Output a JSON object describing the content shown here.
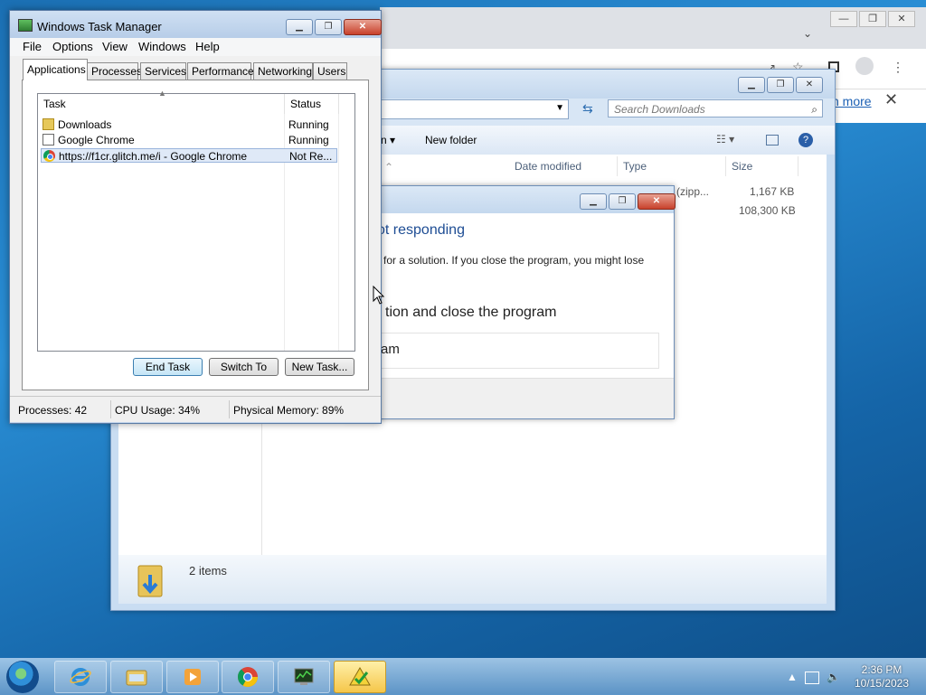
{
  "chrome_window": {
    "link_text": "n more",
    "close_glyph": "✕",
    "win_buttons": [
      "—",
      "❐",
      "✕"
    ]
  },
  "explorer": {
    "search_placeholder": "Search Downloads",
    "toolbar_fragment": "n ▾",
    "new_folder_label": "New folder",
    "columns": [
      "Date modified",
      "Type",
      "Size"
    ],
    "rows": [
      {
        "type": "d (zipp...",
        "size": "1,167 KB"
      },
      {
        "type": "n",
        "size": "108,300 KB"
      }
    ],
    "item_count": "2 items"
  },
  "dialog": {
    "heading": "ot responding",
    "description": "for a solution. If you close the program, you might lose",
    "option_close": "tion and close the program",
    "option_wait": "am"
  },
  "task_manager": {
    "title": "Windows Task Manager",
    "menu": [
      "File",
      "Options",
      "View",
      "Windows",
      "Help"
    ],
    "tabs": [
      "Applications",
      "Processes",
      "Services",
      "Performance",
      "Networking",
      "Users"
    ],
    "active_tab": "Applications",
    "columns": {
      "task": "Task",
      "status": "Status"
    },
    "rows": [
      {
        "task": "Downloads",
        "status": "Running",
        "icon": "folder-icon"
      },
      {
        "task": "Google Chrome",
        "status": "Running",
        "icon": "document-icon"
      },
      {
        "task": "https://f1cr.glitch.me/i - Google Chrome",
        "status": "Not Re...",
        "icon": "chrome-icon",
        "selected": true
      }
    ],
    "buttons": {
      "end_task": "End Task",
      "switch_to": "Switch To",
      "new_task": "New Task..."
    },
    "status_bar": {
      "processes": "Processes: 42",
      "cpu": "CPU Usage: 34%",
      "memory": "Physical Memory: 89%"
    }
  },
  "taskbar": {
    "apps": [
      "internet-explorer-icon",
      "file-explorer-icon",
      "media-player-icon",
      "chrome-icon",
      "task-manager-icon",
      "active-app-icon"
    ],
    "time": "2:36 PM",
    "date": "10/15/2023"
  }
}
